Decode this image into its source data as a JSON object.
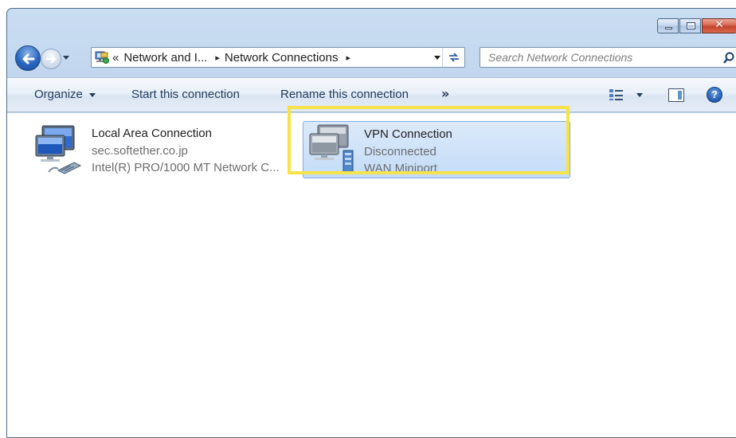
{
  "window": {
    "controls": {
      "minimize": "minimize",
      "maximize": "maximize",
      "close": "✕"
    }
  },
  "address": {
    "crumbs": [
      "«",
      "Network and I...",
      "Network Connections"
    ],
    "crumb_separator": "▸"
  },
  "search": {
    "placeholder": "Search Network Connections"
  },
  "toolbar": {
    "organize": "Organize",
    "start": "Start this connection",
    "rename": "Rename this connection",
    "more": "»",
    "help": "?"
  },
  "connections": [
    {
      "name": "Local Area Connection",
      "line2": "sec.softether.co.jp",
      "line3": "Intel(R) PRO/1000 MT Network C..."
    },
    {
      "name": "VPN Connection",
      "line2": "Disconnected",
      "line3": "WAN Miniport"
    }
  ],
  "colors": {
    "highlight": "#f6e24a",
    "selection": "#c3dcf7",
    "toolbar_text": "#1e395b"
  },
  "icons": {
    "back": "back-arrow-icon",
    "forward": "forward-arrow-icon",
    "network_folder": "network-folder-icon",
    "refresh": "refresh-icon",
    "search": "search-icon",
    "view": "view-options-icon",
    "preview_pane": "preview-pane-icon",
    "help": "help-icon",
    "lan": "lan-computer-icon",
    "vpn": "vpn-computer-icon"
  }
}
